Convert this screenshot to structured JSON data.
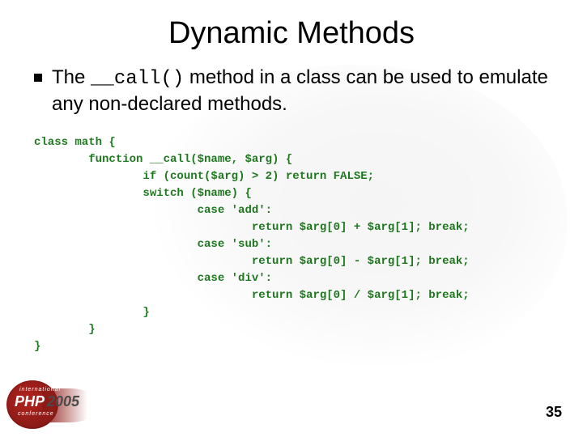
{
  "title": "Dynamic Methods",
  "bullet": {
    "pre": "The ",
    "code": "__call()",
    "post": " method in a class can be used to emulate any non-declared methods."
  },
  "code": "class math {\n        function __call($name, $arg) {\n                if (count($arg) > 2) return FALSE;\n                switch ($name) {\n                        case 'add':\n                                return $arg[0] + $arg[1]; break;\n                        case 'sub':\n                                return $arg[0] - $arg[1]; break;\n                        case 'div':\n                                return $arg[0] / $arg[1]; break;\n                }\n        }\n}",
  "page": "35",
  "logo": {
    "line1": "international",
    "line2": "PHP",
    "line3": "conference",
    "year": "2005"
  }
}
